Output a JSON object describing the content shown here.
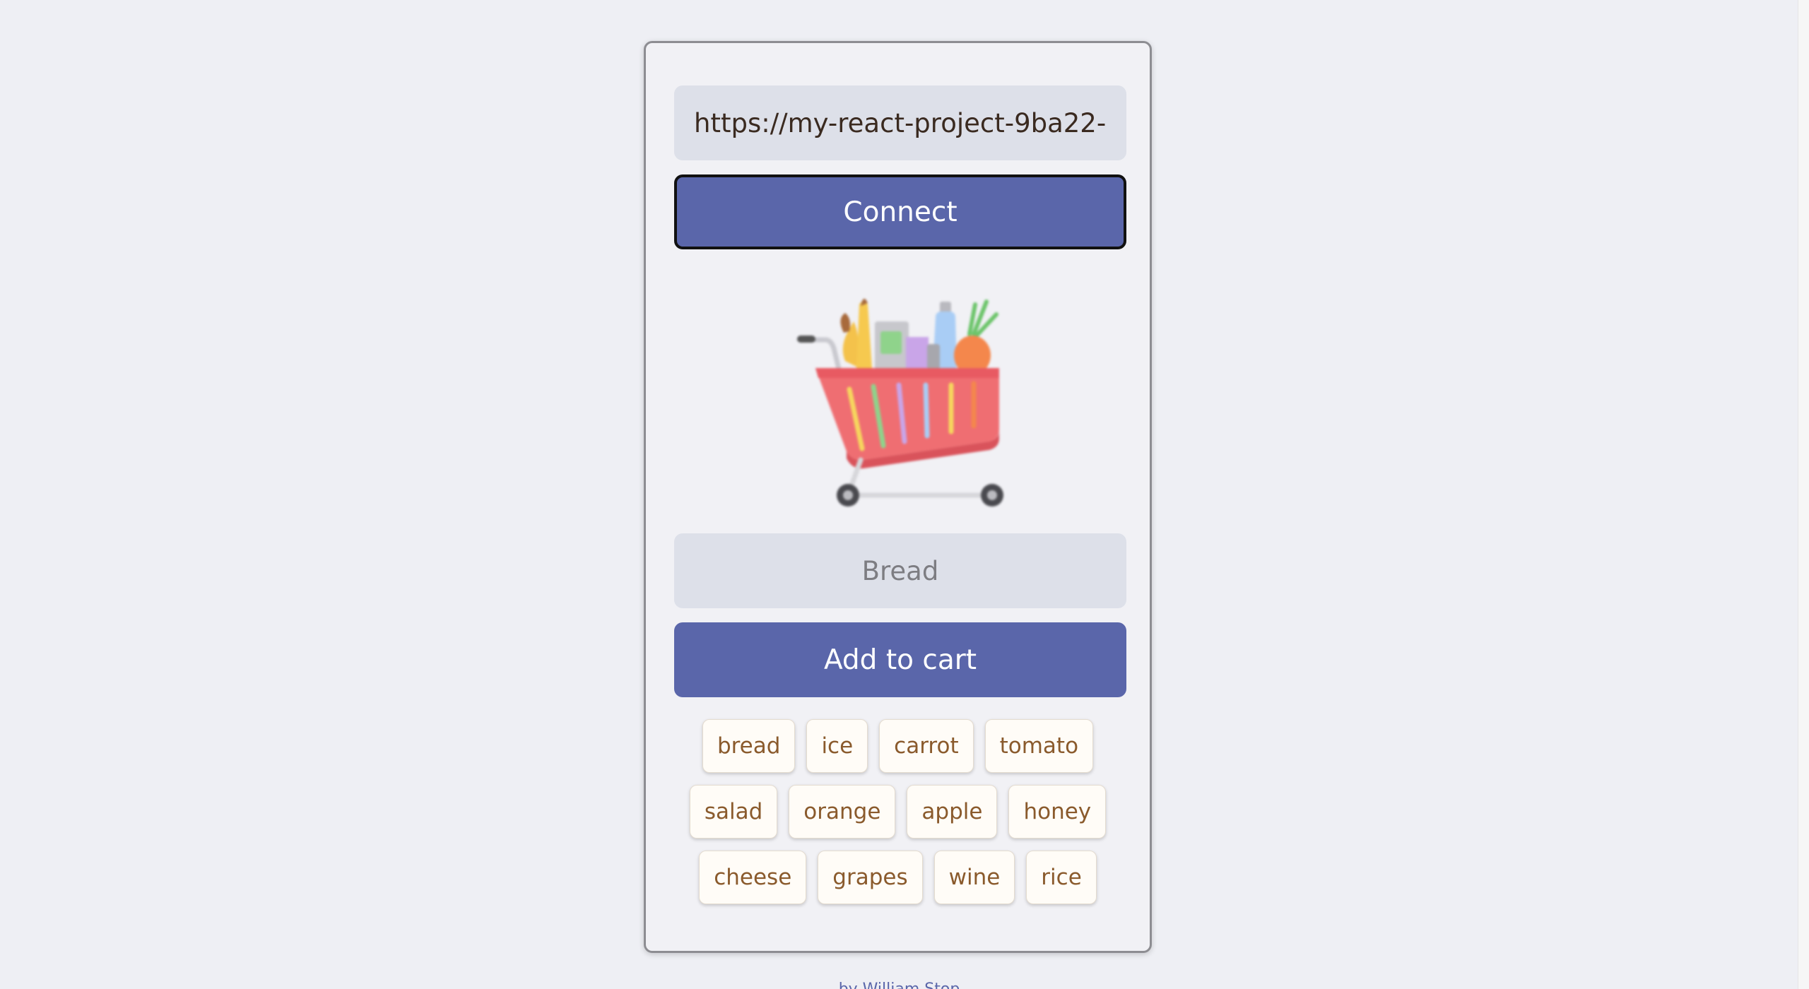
{
  "connection": {
    "url_value": "https://my-react-project-9ba22-",
    "connect_label": "Connect"
  },
  "cart": {
    "icon": "shopping-cart-illustration",
    "item_placeholder": "Bread",
    "add_label": "Add to cart"
  },
  "suggestions": {
    "rows": [
      [
        "bread",
        "ice",
        "carrot",
        "tomato"
      ],
      [
        "salad",
        "orange",
        "apple",
        "honey"
      ],
      [
        "cheese",
        "grapes",
        "wine",
        "rice"
      ]
    ]
  },
  "footer": {
    "text": "by William Stop"
  },
  "colors": {
    "background": "#eeeff4",
    "accent": "#5a66aa",
    "chip_text": "#8a5a2c",
    "input_bg": "#dde0e9"
  }
}
